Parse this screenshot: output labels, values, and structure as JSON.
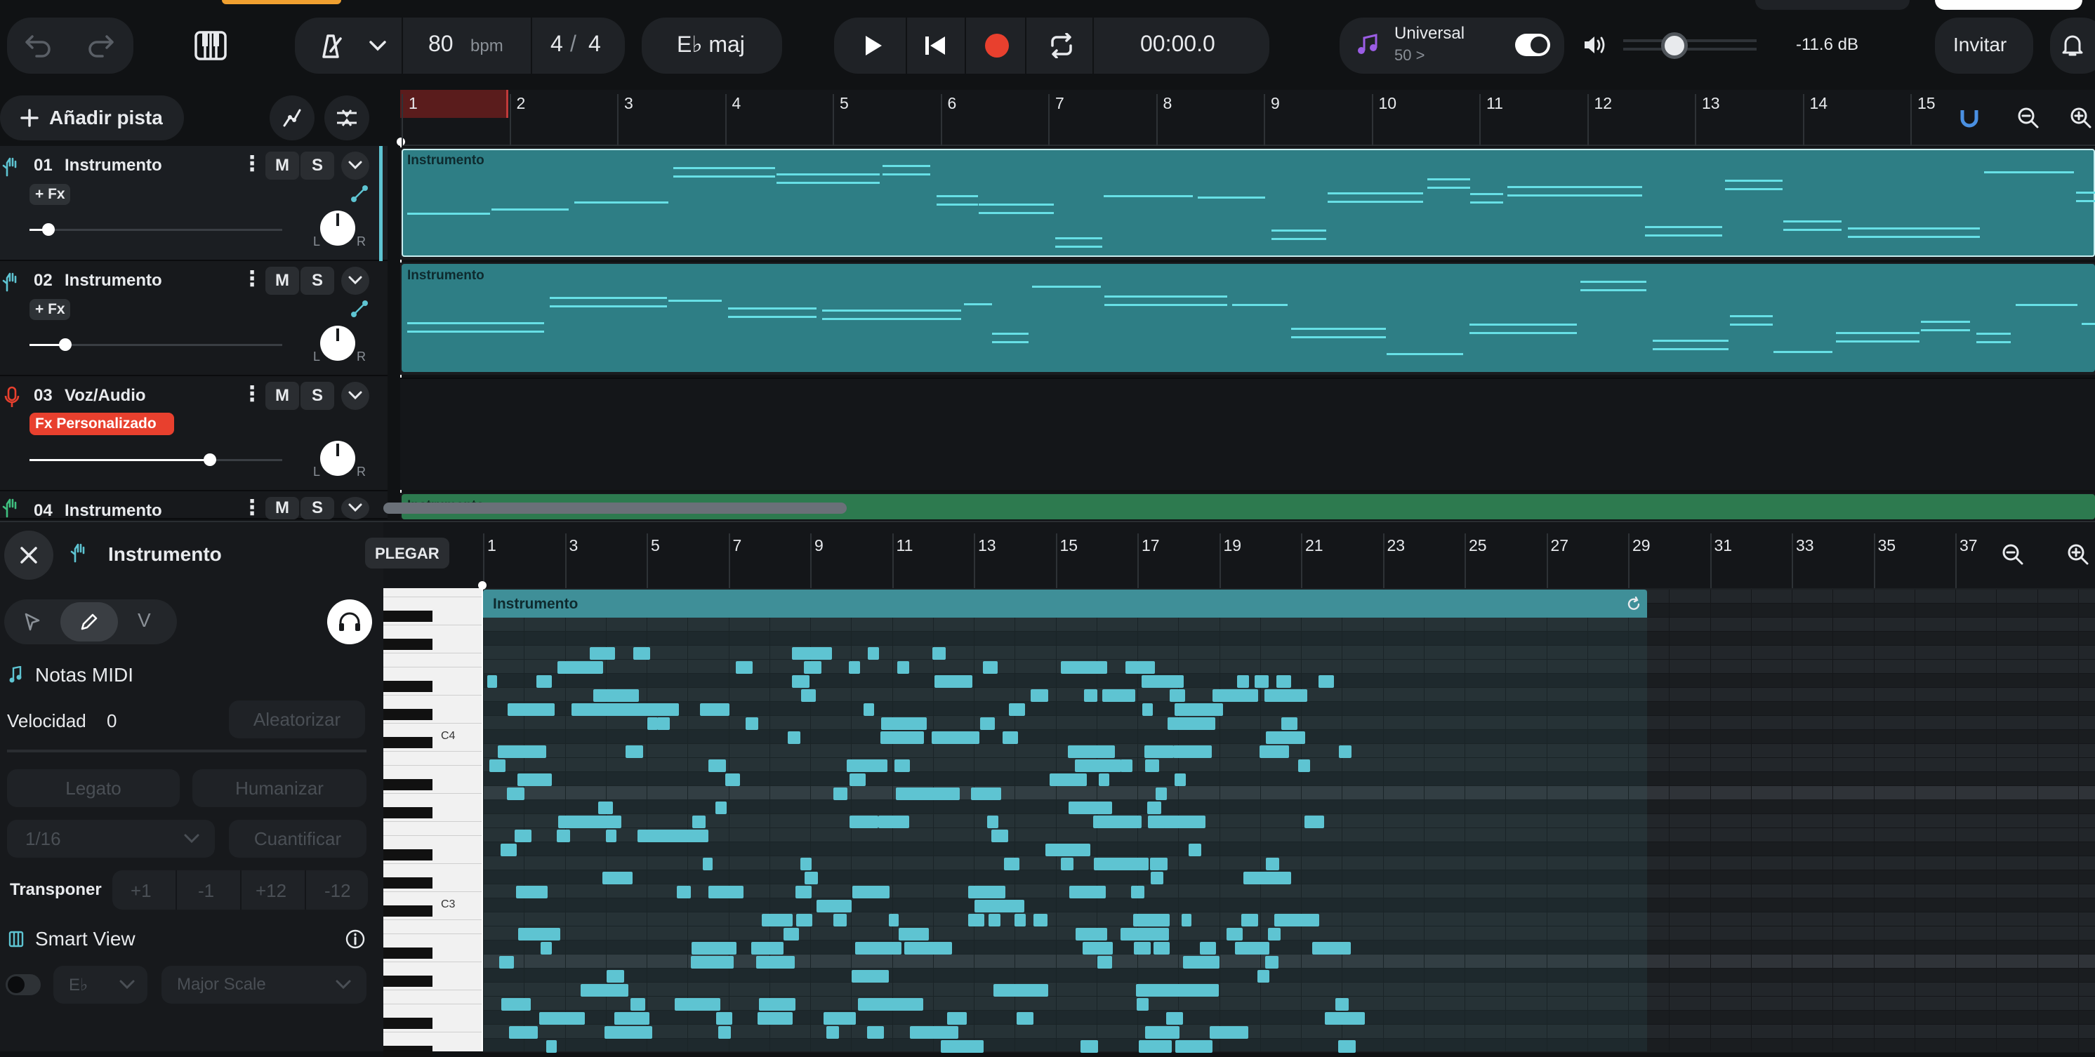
{
  "toolbar": {
    "tempo_value": "80",
    "tempo_unit": "bpm",
    "time_sig_num": "4",
    "time_sig_sep": "/",
    "time_sig_den": "4",
    "key": "E♭ maj",
    "time_display": "00:00.0",
    "sound_pack_title": "Universal",
    "sound_pack_sub": "50 >",
    "volume_db": "-11.6 dB",
    "invite_label": "Invitar"
  },
  "tracks_panel": {
    "add_track_label": "Añadir pista",
    "tracks": [
      {
        "number": "01",
        "name": "Instrumento",
        "fx": "+ Fx"
      },
      {
        "number": "02",
        "name": "Instrumento",
        "fx": "+ Fx"
      },
      {
        "number": "03",
        "name": "Voz/Audio",
        "fx": "Fx Personalizado"
      },
      {
        "number": "04",
        "name": "Instrumento"
      }
    ],
    "mute": "M",
    "solo": "S",
    "pan_left": "L",
    "pan_right": "R"
  },
  "timeline": {
    "bars": [
      "1",
      "2",
      "3",
      "4",
      "5",
      "6",
      "7",
      "8",
      "9",
      "10",
      "11",
      "12",
      "13",
      "14",
      "15"
    ],
    "clip_label": "Instrumento"
  },
  "editor": {
    "title": "Instrumento",
    "collapse_label": "PLEGAR",
    "velocity_mode_label": "V",
    "midi_notes_label": "Notas MIDI",
    "velocity_label": "Velocidad",
    "velocity_value": "0",
    "randomize_label": "Aleatorizar",
    "legato_label": "Legato",
    "humanize_label": "Humanizar",
    "grid_value": "1/16",
    "quantize_label": "Cuantificar",
    "transpose_label": "Transponer",
    "transpose_options": [
      "+1",
      "-1",
      "+12",
      "-12"
    ],
    "smart_view_label": "Smart View",
    "smart_key": "E♭",
    "smart_scale": "Major Scale",
    "ruler": [
      "1",
      "3",
      "5",
      "7",
      "9",
      "11",
      "13",
      "15",
      "17",
      "19",
      "21",
      "23",
      "25",
      "27",
      "29",
      "31",
      "33",
      "35",
      "37"
    ],
    "piano_labels": [
      "C4",
      "C3"
    ],
    "clip_label": "Instrumento"
  },
  "colors": {
    "accent": "#5ec4d2",
    "record": "#e8402e",
    "fx_badge": "#e8402e"
  }
}
